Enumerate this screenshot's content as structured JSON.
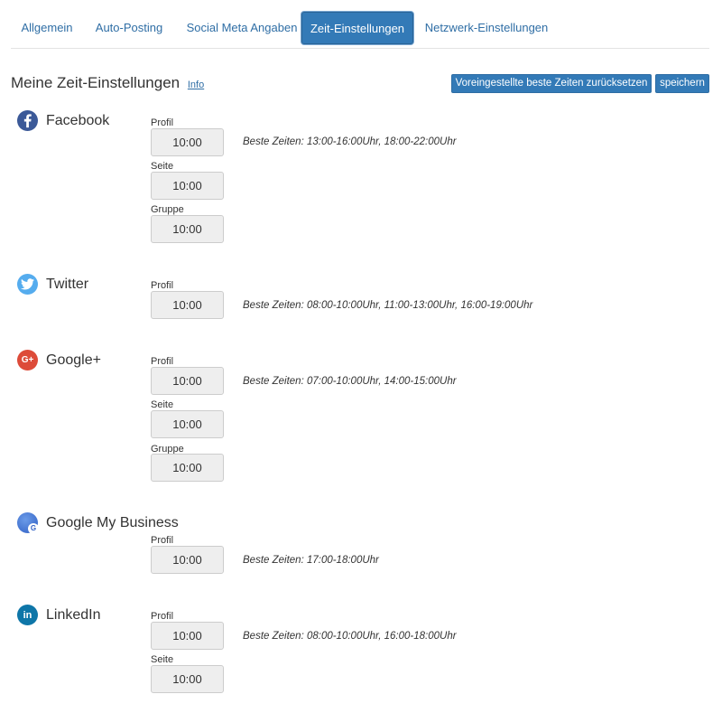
{
  "tabs": [
    {
      "label": "Allgemein",
      "active": false
    },
    {
      "label": "Auto-Posting",
      "active": false
    },
    {
      "label": "Social Meta Angaben",
      "active": false
    },
    {
      "label": "Zeit-Einstellungen",
      "active": true
    },
    {
      "label": "Netzwerk-Einstellungen",
      "active": false
    }
  ],
  "header": {
    "title": "Meine Zeit-Einstellungen",
    "info_link": "Info",
    "reset_button": "Voreingestellte beste Zeiten zurücksetzen",
    "save_button": "speichern"
  },
  "networks": [
    {
      "name": "Facebook",
      "icon": "facebook-icon",
      "color": "#3b5998",
      "best_times": "Beste Zeiten: 13:00-16:00Uhr, 18:00-22:00Uhr",
      "fields": [
        {
          "label": "Profil",
          "value": "10:00"
        },
        {
          "label": "Seite",
          "value": "10:00"
        },
        {
          "label": "Gruppe",
          "value": "10:00"
        }
      ]
    },
    {
      "name": "Twitter",
      "icon": "twitter-icon",
      "color": "#55acee",
      "best_times": "Beste Zeiten: 08:00-10:00Uhr, 11:00-13:00Uhr, 16:00-19:00Uhr",
      "fields": [
        {
          "label": "Profil",
          "value": "10:00"
        }
      ]
    },
    {
      "name": "Google+",
      "icon": "google-plus-icon",
      "color": "#dd4b39",
      "best_times": "Beste Zeiten: 07:00-10:00Uhr, 14:00-15:00Uhr",
      "fields": [
        {
          "label": "Profil",
          "value": "10:00"
        },
        {
          "label": "Seite",
          "value": "10:00"
        },
        {
          "label": "Gruppe",
          "value": "10:00"
        }
      ]
    },
    {
      "name": "Google My Business",
      "icon": "google-my-business-icon",
      "color": "#4a78d1",
      "best_times": "Beste Zeiten: 17:00-18:00Uhr",
      "fields": [
        {
          "label": "Profil",
          "value": "10:00"
        }
      ]
    },
    {
      "name": "LinkedIn",
      "icon": "linkedin-icon",
      "color": "#0e76a8",
      "best_times": "Beste Zeiten: 08:00-10:00Uhr, 16:00-18:00Uhr",
      "fields": [
        {
          "label": "Profil",
          "value": "10:00"
        },
        {
          "label": "Seite",
          "value": "10:00"
        }
      ]
    }
  ]
}
